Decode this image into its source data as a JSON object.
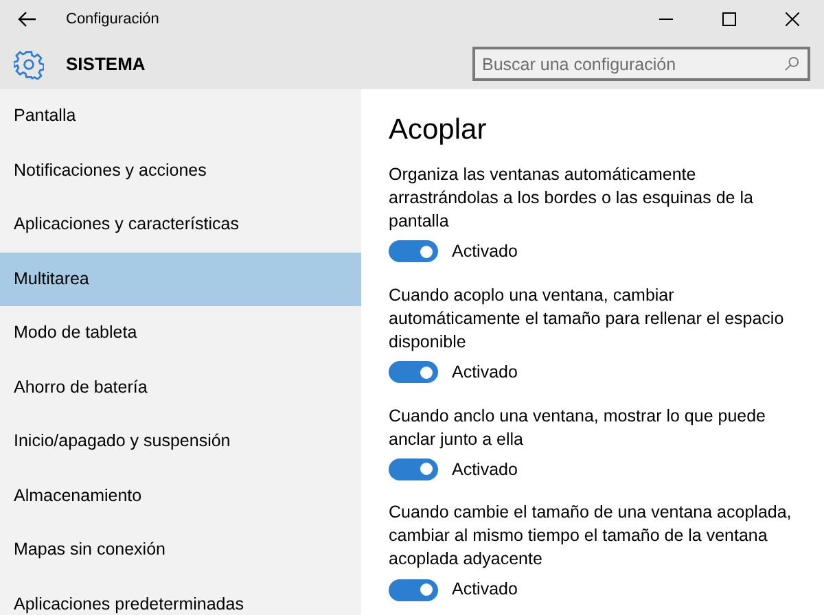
{
  "window": {
    "title": "Configuración"
  },
  "header": {
    "title": "SISTEMA",
    "search": {
      "placeholder": "Buscar una configuración"
    }
  },
  "sidebar": {
    "items": [
      {
        "label": "Pantalla",
        "selected": false
      },
      {
        "label": "Notificaciones y acciones",
        "selected": false
      },
      {
        "label": "Aplicaciones y características",
        "selected": false
      },
      {
        "label": "Multitarea",
        "selected": true
      },
      {
        "label": "Modo de tableta",
        "selected": false
      },
      {
        "label": "Ahorro de batería",
        "selected": false
      },
      {
        "label": "Inicio/apagado y suspensión",
        "selected": false
      },
      {
        "label": "Almacenamiento",
        "selected": false
      },
      {
        "label": "Mapas sin conexión",
        "selected": false
      },
      {
        "label": "Aplicaciones predeterminadas",
        "selected": false
      }
    ]
  },
  "content": {
    "title": "Acoplar",
    "settings": [
      {
        "description": "Organiza las ventanas automáticamente arrastrándolas a los bordes o las esquinas de la pantalla",
        "on": true,
        "state": "Activado"
      },
      {
        "description": "Cuando acoplo una ventana, cambiar automáticamente el tamaño para rellenar el espacio disponible",
        "on": true,
        "state": "Activado"
      },
      {
        "description": "Cuando anclo una ventana, mostrar lo que puede anclar junto a ella",
        "on": true,
        "state": "Activado"
      },
      {
        "description": "Cuando cambie el tamaño de una ventana acoplada, cambiar al mismo tiempo el tamaño de la ventana acoplada adyacente",
        "on": true,
        "state": "Activado"
      }
    ]
  }
}
